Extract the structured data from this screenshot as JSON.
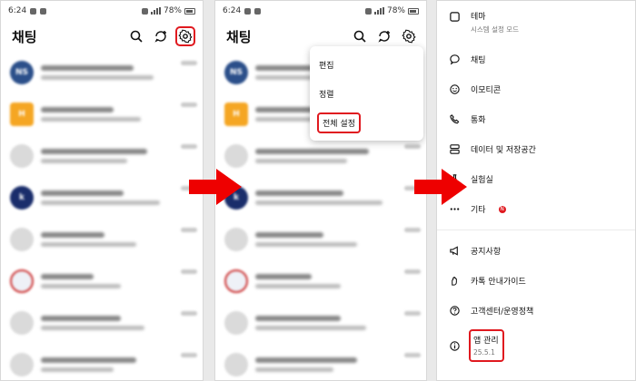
{
  "status": {
    "time": "6:24",
    "battery": "78%"
  },
  "panel1": {
    "title": "채팅",
    "chats": [
      {
        "avatar_text": "NS",
        "avatar_color": "blue"
      },
      {
        "avatar_text": "H",
        "avatar_color": "orange"
      },
      {
        "avatar_text": "",
        "avatar_color": "gray"
      },
      {
        "avatar_text": "k",
        "avatar_color": "navy"
      },
      {
        "avatar_text": "",
        "avatar_color": "gray"
      },
      {
        "avatar_text": "",
        "avatar_color": "flag"
      },
      {
        "avatar_text": "",
        "avatar_color": "gray"
      },
      {
        "avatar_text": "",
        "avatar_color": "gray"
      }
    ]
  },
  "panel2": {
    "title": "채팅",
    "menu": {
      "edit": "편집",
      "sort": "정렬",
      "all_settings": "전체 설정"
    }
  },
  "panel3": {
    "theme": {
      "label": "테마",
      "sub": "시스템 설정 모드"
    },
    "items": {
      "chat": "채팅",
      "emoticon": "이모티콘",
      "call": "통화",
      "data_storage": "데이터 및 저장공간",
      "lab": "실험실",
      "etc": "기타",
      "notice": "공지사항",
      "guide": "카톡 안내가이드",
      "support": "고객센터/운영정책"
    },
    "app_management": {
      "label": "앱 관리",
      "version": "25.5.1"
    }
  },
  "colors": {
    "highlight": "#e0191f",
    "arrow": "#ee0000"
  },
  "icons": [
    "search-icon",
    "new-chat-icon",
    "gear-icon",
    "theme-icon",
    "chat-bubble-icon",
    "emoticon-icon",
    "phone-icon",
    "storage-icon",
    "flask-icon",
    "more-dots-icon",
    "megaphone-icon",
    "hand-icon",
    "help-icon",
    "info-icon",
    "arrow-right-icon"
  ]
}
